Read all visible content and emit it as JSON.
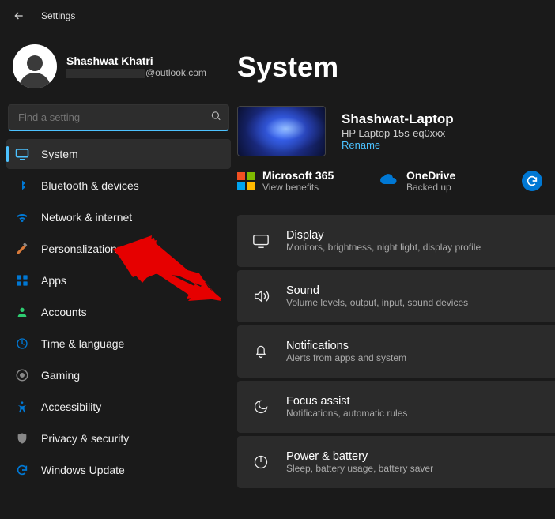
{
  "window": {
    "title": "Settings"
  },
  "profile": {
    "name": "Shashwat Khatri",
    "email_domain": "@outlook.com"
  },
  "search": {
    "placeholder": "Find a setting"
  },
  "nav": [
    {
      "id": "system",
      "label": "System"
    },
    {
      "id": "bluetooth",
      "label": "Bluetooth & devices"
    },
    {
      "id": "network",
      "label": "Network & internet"
    },
    {
      "id": "personalization",
      "label": "Personalization"
    },
    {
      "id": "apps",
      "label": "Apps"
    },
    {
      "id": "accounts",
      "label": "Accounts"
    },
    {
      "id": "time",
      "label": "Time & language"
    },
    {
      "id": "gaming",
      "label": "Gaming"
    },
    {
      "id": "accessibility",
      "label": "Accessibility"
    },
    {
      "id": "privacy",
      "label": "Privacy & security"
    },
    {
      "id": "update",
      "label": "Windows Update"
    }
  ],
  "page": {
    "title": "System",
    "device_name": "Shashwat-Laptop",
    "device_model": "HP Laptop 15s-eq0xxx",
    "rename": "Rename",
    "m365": {
      "title": "Microsoft 365",
      "sub": "View benefits"
    },
    "onedrive": {
      "title": "OneDrive",
      "sub": "Backed up"
    }
  },
  "cards": [
    {
      "id": "display",
      "title": "Display",
      "desc": "Monitors, brightness, night light, display profile"
    },
    {
      "id": "sound",
      "title": "Sound",
      "desc": "Volume levels, output, input, sound devices"
    },
    {
      "id": "notifications",
      "title": "Notifications",
      "desc": "Alerts from apps and system"
    },
    {
      "id": "focus",
      "title": "Focus assist",
      "desc": "Notifications, automatic rules"
    },
    {
      "id": "power",
      "title": "Power & battery",
      "desc": "Sleep, battery usage, battery saver"
    }
  ]
}
